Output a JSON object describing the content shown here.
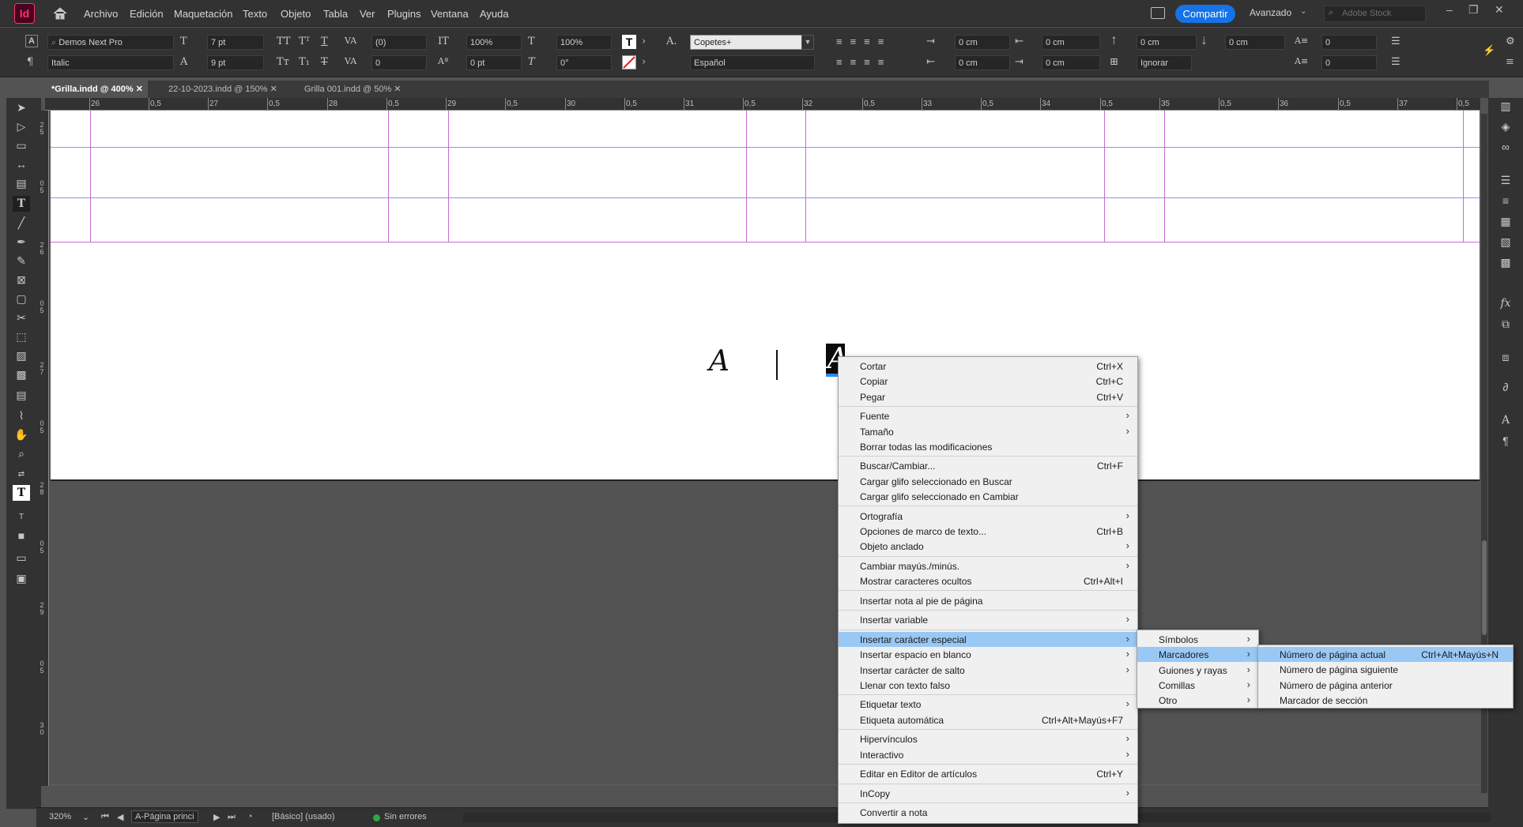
{
  "app": {
    "logo": "Id"
  },
  "menubar": {
    "items": [
      "Archivo",
      "Edición",
      "Maquetación",
      "Texto",
      "Objeto",
      "Tabla",
      "Ver",
      "Plugins",
      "Ventana",
      "Ayuda"
    ],
    "share": "Compartir",
    "workspace": "Avanzado",
    "stock_placeholder": "Adobe Stock"
  },
  "control": {
    "font_family": "Demos Next Pro",
    "font_style": "Italic",
    "size": "7 pt",
    "leading": "9 pt",
    "kerning": "(0)",
    "tracking": "0",
    "vscale": "100%",
    "hscale": "100%",
    "baseline": "0 pt",
    "skew": "0°",
    "char_style": "Copetes+",
    "language": "Español",
    "left_indent": "0 cm",
    "right_indent": "0 cm",
    "first_indent": "0 cm",
    "last_indent": "0 cm",
    "space_before": "0 cm",
    "space_after": "0 cm",
    "grid": "Ignorar",
    "drop_lines": "0",
    "drop_chars": "0"
  },
  "tabs": [
    "*Grilla.indd @ 400%",
    "22-10-2023.indd @ 150%",
    "Grilla 001.indd @ 50%"
  ],
  "ruler": {
    "h": [
      "26",
      "0,5",
      "27",
      "0,5",
      "28",
      "0,5",
      "29",
      "0,5",
      "30",
      "0,5",
      "31",
      "0,5",
      "32",
      "0,5",
      "33",
      "0,5",
      "34",
      "0,5",
      "35",
      "0,5",
      "36",
      "0,5",
      "37",
      "0,5"
    ],
    "v": [
      "2\n5",
      "0\n5",
      "2\n6",
      "0\n5",
      "2\n7",
      "0\n5",
      "2\n8",
      "0\n5",
      "2\n9",
      "0\n5",
      "3\n0"
    ]
  },
  "canvas": {
    "glyph_left": "A",
    "glyph_selected": "A"
  },
  "status": {
    "zoom": "320%",
    "page": "A-Página princi",
    "style": "[Básico] (usado)",
    "preflight": "Sin errores"
  },
  "context_menu": [
    {
      "label": "Cortar",
      "shortcut": "Ctrl+X"
    },
    {
      "label": "Copiar",
      "shortcut": "Ctrl+C"
    },
    {
      "label": "Pegar",
      "shortcut": "Ctrl+V"
    },
    {
      "sep": true
    },
    {
      "label": "Fuente",
      "submenu": true
    },
    {
      "label": "Tamaño",
      "submenu": true
    },
    {
      "label": "Borrar todas las modificaciones"
    },
    {
      "sep": true
    },
    {
      "label": "Buscar/Cambiar...",
      "shortcut": "Ctrl+F"
    },
    {
      "label": "Cargar glifo seleccionado en Buscar"
    },
    {
      "label": "Cargar glifo seleccionado en Cambiar"
    },
    {
      "sep": true
    },
    {
      "label": "Ortografía",
      "submenu": true
    },
    {
      "label": "Opciones de marco de texto...",
      "shortcut": "Ctrl+B"
    },
    {
      "label": "Objeto anclado",
      "submenu": true
    },
    {
      "sep": true
    },
    {
      "label": "Cambiar mayús./minús.",
      "submenu": true
    },
    {
      "label": "Mostrar caracteres ocultos",
      "shortcut": "Ctrl+Alt+I"
    },
    {
      "sep": true
    },
    {
      "label": "Insertar nota al pie de página"
    },
    {
      "sep": true
    },
    {
      "label": "Insertar variable",
      "submenu": true
    },
    {
      "sep": true
    },
    {
      "label": "Insertar carácter especial",
      "submenu": true,
      "highlight": true
    },
    {
      "label": "Insertar espacio en blanco",
      "submenu": true
    },
    {
      "label": "Insertar carácter de salto",
      "submenu": true
    },
    {
      "label": "Llenar con texto falso"
    },
    {
      "sep": true
    },
    {
      "label": "Etiquetar texto",
      "submenu": true
    },
    {
      "label": "Etiqueta automática",
      "shortcut": "Ctrl+Alt+Mayús+F7"
    },
    {
      "sep": true
    },
    {
      "label": "Hipervínculos",
      "submenu": true
    },
    {
      "label": "Interactivo",
      "submenu": true
    },
    {
      "sep": true
    },
    {
      "label": "Editar en Editor de artículos",
      "shortcut": "Ctrl+Y"
    },
    {
      "sep": true
    },
    {
      "label": "InCopy",
      "submenu": true
    },
    {
      "sep": true
    },
    {
      "label": "Convertir a nota"
    }
  ],
  "submenu1": [
    {
      "label": "Símbolos",
      "submenu": true
    },
    {
      "label": "Marcadores",
      "submenu": true,
      "highlight": true
    },
    {
      "label": "Guiones y rayas",
      "submenu": true
    },
    {
      "label": "Comillas",
      "submenu": true
    },
    {
      "label": "Otro",
      "submenu": true
    }
  ],
  "submenu2": [
    {
      "label": "Número de página actual",
      "shortcut": "Ctrl+Alt+Mayús+N",
      "highlight": true
    },
    {
      "label": "Número de página siguiente"
    },
    {
      "label": "Número de página anterior"
    },
    {
      "label": "Marcador de sección"
    }
  ]
}
